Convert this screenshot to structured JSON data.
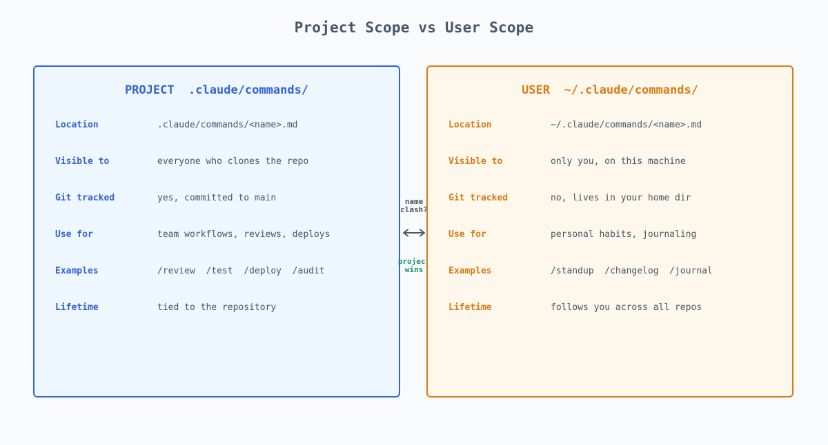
{
  "title": "Project Scope vs User Scope",
  "project": {
    "heading": "PROJECT  .claude/commands/",
    "rows": [
      {
        "label": "Location",
        "value": ".claude/commands/<name>.md"
      },
      {
        "label": "Visible to",
        "value": "everyone who clones the repo"
      },
      {
        "label": "Git tracked",
        "value": "yes, committed to main"
      },
      {
        "label": "Use for",
        "value": "team workflows, reviews, deploys"
      },
      {
        "label": "Examples",
        "value": "/review  /test  /deploy  /audit"
      },
      {
        "label": "Lifetime",
        "value": "tied to the repository"
      }
    ]
  },
  "user": {
    "heading": "USER  ~/.claude/commands/",
    "rows": [
      {
        "label": "Location",
        "value": "~/.claude/commands/<name>.md"
      },
      {
        "label": "Visible to",
        "value": "only you, on this machine"
      },
      {
        "label": "Git tracked",
        "value": "no, lives in your home dir"
      },
      {
        "label": "Use for",
        "value": "personal habits, journaling"
      },
      {
        "label": "Examples",
        "value": "/standup  /changelog  /journal"
      },
      {
        "label": "Lifetime",
        "value": "follows you across all repos"
      }
    ]
  },
  "connector": {
    "top_label": "name\nclash?",
    "bottom_label": "project\nwins"
  },
  "colors": {
    "project_accent": "#3563d0",
    "user_accent": "#d97b16",
    "resolution": "#15936a"
  }
}
